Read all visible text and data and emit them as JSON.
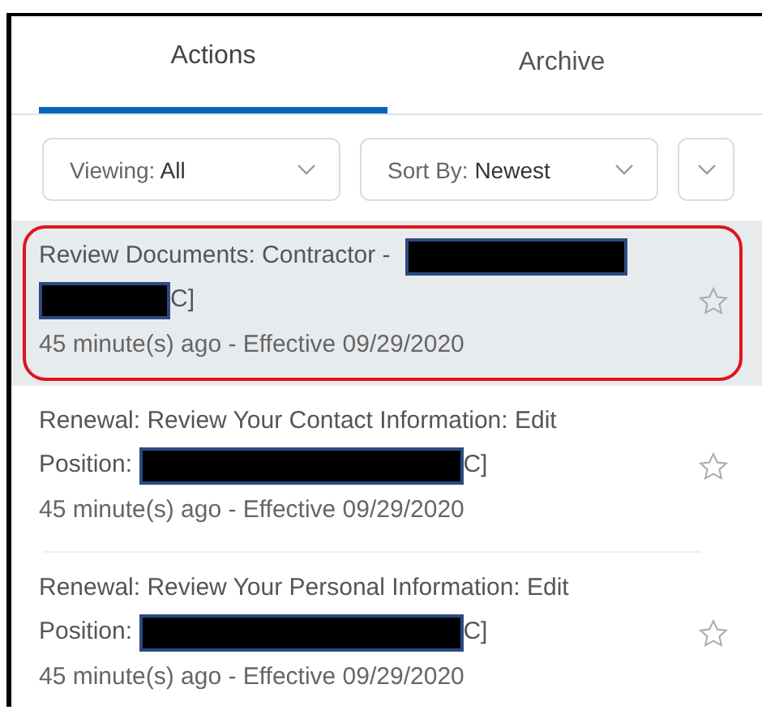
{
  "tabs": [
    {
      "label": "Actions",
      "selected": true
    },
    {
      "label": "Archive",
      "selected": false
    }
  ],
  "filters": [
    {
      "kind": "select",
      "label": "Viewing:",
      "value": "All"
    },
    {
      "kind": "select",
      "label": "Sort By:",
      "value": "Newest"
    },
    {
      "kind": "menu"
    }
  ],
  "items": [
    {
      "selected": true,
      "annotated": true,
      "starred": false,
      "title": [
        {
          "kind": "text",
          "text": "Review Documents: Contractor -"
        },
        {
          "kind": "redaction_medium"
        },
        {
          "kind": "break"
        },
        {
          "kind": "redaction_short"
        },
        {
          "kind": "text",
          "text": "C]"
        }
      ],
      "meta": "45 minute(s) ago - Effective 09/29/2020"
    },
    {
      "selected": false,
      "annotated": false,
      "starred": false,
      "title": [
        {
          "kind": "text",
          "text": "Renewal: Review Your Contact Information: Edit"
        },
        {
          "kind": "break"
        },
        {
          "kind": "text",
          "text": "Position:"
        },
        {
          "kind": "redaction_long"
        },
        {
          "kind": "text",
          "text": "C]"
        }
      ],
      "meta": "45 minute(s) ago - Effective 09/29/2020"
    },
    {
      "selected": false,
      "annotated": false,
      "starred": false,
      "title": [
        {
          "kind": "text",
          "text": "Renewal: Review Your Personal Information: Edit"
        },
        {
          "kind": "break"
        },
        {
          "kind": "text",
          "text": "Position:"
        },
        {
          "kind": "redaction_long"
        },
        {
          "kind": "text",
          "text": "C]"
        }
      ],
      "meta": "45 minute(s) ago - Effective 09/29/2020"
    }
  ]
}
